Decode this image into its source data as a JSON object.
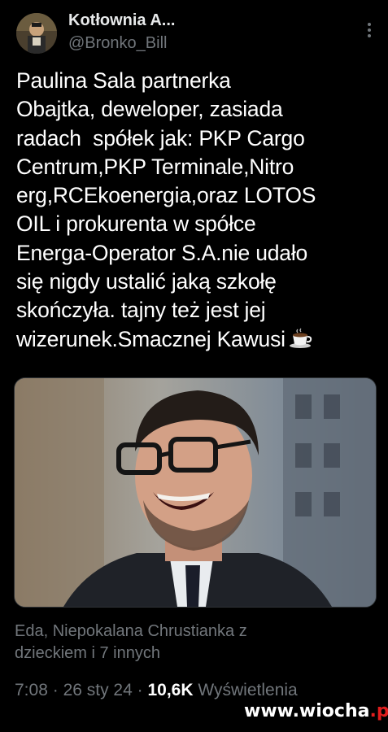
{
  "author": {
    "name": "Kotłownia A...",
    "handle": "@Bronko_Bill"
  },
  "more_icon": "more-vertical-icon",
  "tweet": {
    "lines": [
      "Paulina Sala partnerka",
      "Obajtka, deweloper, zasiada",
      "radach  spółek jak: PKP Cargo",
      "Centrum,PKP Terminale,Nitro",
      "erg,RCEkoenergia,oraz LOTOS",
      "OIL i prokurenta w spółce",
      "Energa-Operator S.A.nie udało",
      "się nigdy ustalić jaką szkołę",
      "skończyła. tajny też jest jej",
      "wizerunek.Smacznej Kawusi"
    ],
    "emoji": "coffee-cup-icon"
  },
  "likes_line1": "Eda, Niepokalana Chrustianka z",
  "likes_line2": "dzieckiem i 7 innych",
  "meta": {
    "time": "7:08",
    "separator": "·",
    "date": "26 sty 24",
    "views_count": "10,6K",
    "views_label": "Wyświetlenia"
  },
  "watermark": {
    "prefix": "www",
    "mid": ".wiocha",
    "suffix": ".pl"
  },
  "colors": {
    "background": "#000000",
    "primary_text": "#e7e9ea",
    "secondary_text": "#71767b",
    "watermark_accent": "#e11d1d"
  }
}
